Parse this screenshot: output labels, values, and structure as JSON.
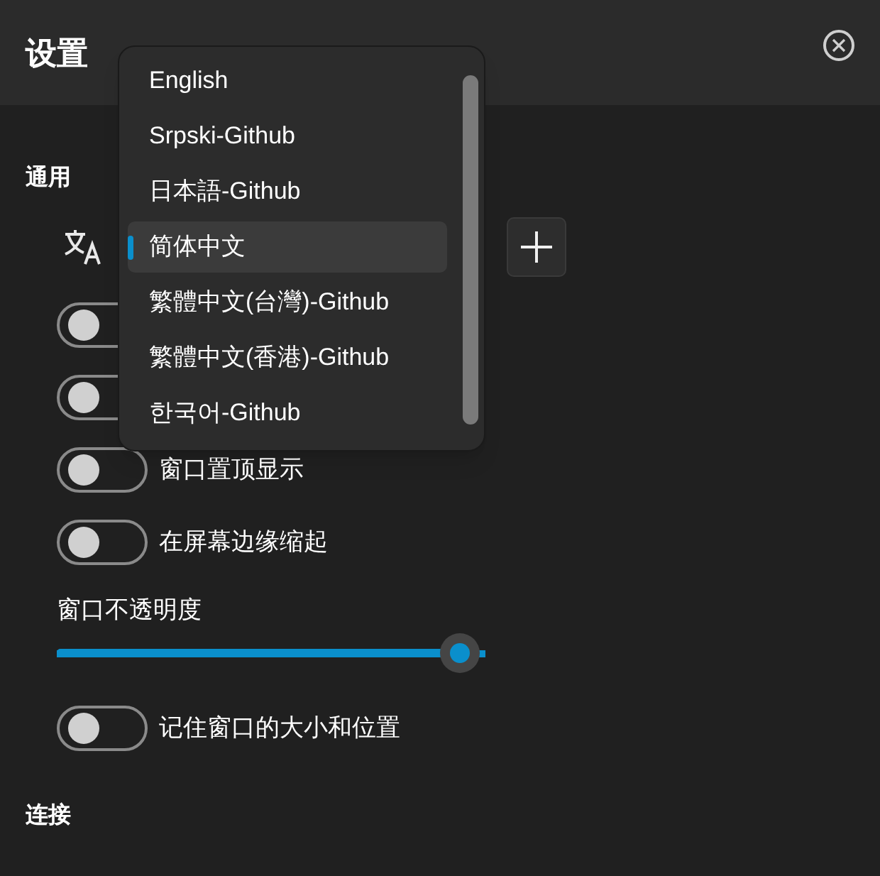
{
  "window": {
    "title": "设置"
  },
  "sections": [
    {
      "title": "通用"
    },
    {
      "title": "连接"
    }
  ],
  "language_menu": {
    "items": [
      {
        "label": "English",
        "selected": false
      },
      {
        "label": "Srpski-Github",
        "selected": false
      },
      {
        "label": "日本語-Github",
        "selected": false
      },
      {
        "label": "简体中文",
        "selected": true
      },
      {
        "label": "繁體中文(台灣)-Github",
        "selected": false
      },
      {
        "label": "繁體中文(香港)-Github",
        "selected": false
      },
      {
        "label": "한국어-Github",
        "selected": false
      }
    ]
  },
  "settings": [
    {
      "kind": "toggle",
      "on": false
    },
    {
      "kind": "toggle",
      "on": false
    },
    {
      "kind": "toggle",
      "label": "窗口置顶显示",
      "on": false
    },
    {
      "kind": "toggle",
      "label": "在屏幕边缘缩起",
      "on": false
    },
    {
      "kind": "slider",
      "label": "窗口不透明度",
      "level": 0.94
    },
    {
      "kind": "toggle",
      "label": "记住窗口的大小和位置",
      "on": false
    }
  ]
}
